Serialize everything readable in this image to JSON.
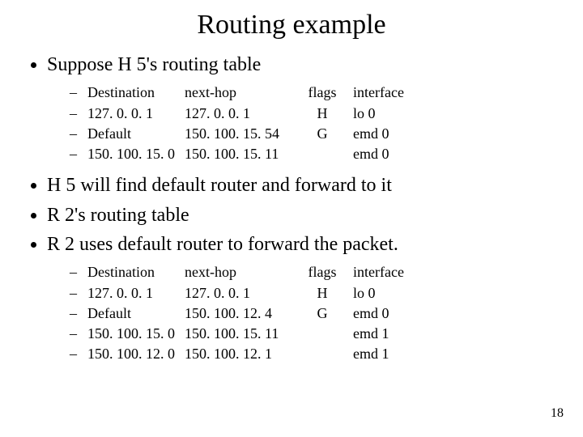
{
  "title": "Routing example",
  "bullets": {
    "b1": "Suppose H 5's routing table",
    "b2": "H 5 will find default router and forward to it",
    "b3": "R 2's routing table",
    "b4": "R 2 uses default router to forward the packet."
  },
  "headers": {
    "dest": "Destination",
    "next": "next-hop",
    "flags": "flags",
    "iface": "interface"
  },
  "dash": "–",
  "table1": [
    {
      "dest": "127. 0. 0. 1",
      "next": "127. 0. 0. 1",
      "flags": "H",
      "iface": "lo 0"
    },
    {
      "dest": "Default",
      "next": "150. 100. 15. 54",
      "flags": "G",
      "iface": "emd 0"
    },
    {
      "dest": "150. 100. 15. 0",
      "next": "150. 100. 15. 11",
      "flags": "",
      "iface": "emd 0"
    }
  ],
  "table2": [
    {
      "dest": "127. 0. 0. 1",
      "next": "127. 0. 0. 1",
      "flags": "H",
      "iface": "lo 0"
    },
    {
      "dest": "Default",
      "next": "150. 100. 12. 4",
      "flags": "G",
      "iface": "emd 0"
    },
    {
      "dest": "150. 100. 15. 0",
      "next": "150. 100. 15. 11",
      "flags": "",
      "iface": "emd 1"
    },
    {
      "dest": "150. 100. 12. 0",
      "next": "150. 100. 12. 1",
      "flags": "",
      "iface": "emd 1"
    }
  ],
  "page_number": "18"
}
